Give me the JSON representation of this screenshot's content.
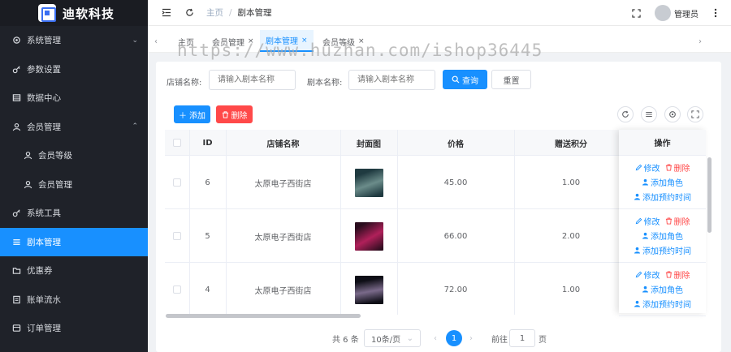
{
  "app": {
    "name": "迪软科技"
  },
  "sidebar": {
    "items": [
      {
        "label": "系统管理",
        "icon": "gear-icon",
        "has_arrow": true
      },
      {
        "label": "参数设置",
        "icon": "key-icon"
      },
      {
        "label": "数据中心",
        "icon": "database-icon"
      },
      {
        "label": "会员管理",
        "icon": "user-icon",
        "has_arrow": true,
        "expanded": true
      },
      {
        "label": "会员等级",
        "icon": "user-icon",
        "sub": true
      },
      {
        "label": "会员管理",
        "icon": "user-icon",
        "sub": true
      },
      {
        "label": "系统工具",
        "icon": "key-icon"
      },
      {
        "label": "剧本管理",
        "icon": "list-icon",
        "active": true
      },
      {
        "label": "优惠券",
        "icon": "folder-icon"
      },
      {
        "label": "账单流水",
        "icon": "document-icon"
      },
      {
        "label": "订单管理",
        "icon": "order-icon"
      }
    ]
  },
  "topbar": {
    "breadcrumb_home": "主页",
    "breadcrumb_sep": "/",
    "breadcrumb_current": "剧本管理",
    "user": "管理员"
  },
  "tabs": [
    {
      "label": "主页",
      "closable": false
    },
    {
      "label": "会员管理",
      "closable": true
    },
    {
      "label": "剧本管理",
      "closable": true,
      "active": true
    },
    {
      "label": "会员等级",
      "closable": true
    }
  ],
  "tab_close": "×",
  "watermark": "https://www.huzhan.com/ishop36445",
  "search": {
    "shop_label": "店铺名称:",
    "shop_placeholder": "请输入剧本名称",
    "script_label": "剧本名称:",
    "script_placeholder": "请输入剧本名称",
    "query_label": "查询",
    "reset_label": "重置"
  },
  "toolbar": {
    "add_label": "添加",
    "delete_label": "删除"
  },
  "table": {
    "headers": {
      "id": "ID",
      "shop": "店铺名称",
      "cover": "封面图",
      "price": "价格",
      "points": "赠送积分",
      "ops": "操作"
    },
    "rows": [
      {
        "id": "6",
        "shop": "太原电子西街店",
        "price": "45.00",
        "points": "1.00",
        "cover_colors": [
          "#1f3a40",
          "#6b8c8a"
        ]
      },
      {
        "id": "5",
        "shop": "太原电子西街店",
        "price": "66.00",
        "points": "2.00",
        "cover_colors": [
          "#2a0d1e",
          "#b0205a"
        ]
      },
      {
        "id": "4",
        "shop": "太原电子西街店",
        "price": "72.00",
        "points": "1.00",
        "cover_colors": [
          "#0e0e16",
          "#7a6a8a"
        ]
      }
    ],
    "op_edit": "修改",
    "op_delete": "删除",
    "op_add_role": "添加角色",
    "op_add_time": "添加预约时间"
  },
  "pagination": {
    "total": "共 6 条",
    "page_size": "10条/页",
    "current_page": "1",
    "goto_label": "前往",
    "goto_value": "1",
    "page_unit": "页"
  },
  "colors": {
    "accent": "#1890ff",
    "danger": "#ff4949",
    "sidebar_bg": "#1f2229"
  }
}
